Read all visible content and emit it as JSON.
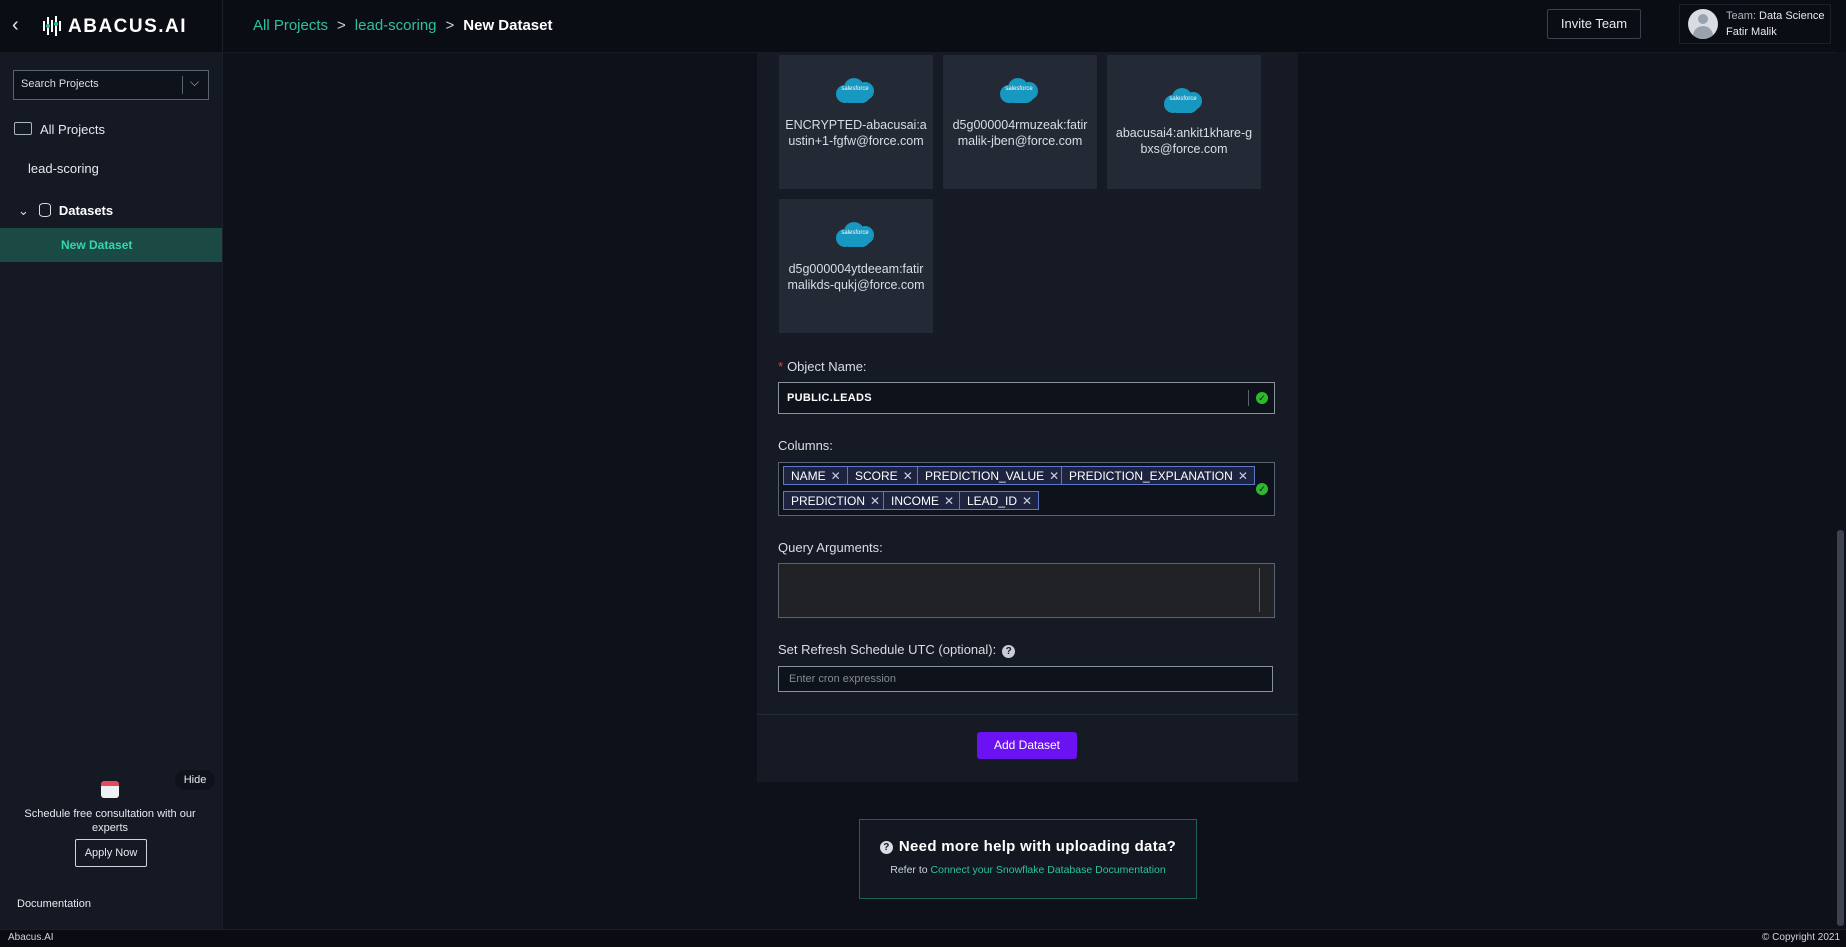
{
  "app": {
    "logo_text": "ABACUS.AI"
  },
  "breadcrumb": {
    "items": [
      "All Projects",
      "lead-scoring"
    ],
    "separator": ">",
    "current": "New Dataset"
  },
  "header": {
    "invite_label": "Invite Team",
    "team_prefix": "Team:",
    "team_name": "Data Science",
    "user_name": "Fatir Malik"
  },
  "sidebar": {
    "search_placeholder": "Search Projects",
    "all_projects": "All Projects",
    "project": "lead-scoring",
    "datasets": "Datasets",
    "new_dataset": "New Dataset",
    "promo": {
      "hide_label": "Hide",
      "text": "Schedule free consultation with our experts",
      "apply_label": "Apply Now"
    },
    "documentation": "Documentation"
  },
  "connectors": [
    {
      "logo_text": "salesforce",
      "label": "ENCRYPTED-abacusai:austin+1-fgfw@force.com"
    },
    {
      "logo_text": "salesforce",
      "label": "d5g000004rmuzeak:fatirmalik-jben@force.com"
    },
    {
      "logo_text": "salesforce",
      "label": "abacusai4:ankit1khare-gbxs@force.com"
    },
    {
      "logo_text": "salesforce",
      "label": "d5g000004ytdeeam:fatirmalikds-qukj@force.com"
    }
  ],
  "form": {
    "object_name_label": "Object Name:",
    "object_name_value": "PUBLIC.LEADS",
    "columns_label": "Columns:",
    "columns": [
      "NAME",
      "SCORE",
      "PREDICTION_VALUE",
      "PREDICTION_EXPLANATION",
      "PREDICTION",
      "INCOME",
      "LEAD_ID"
    ],
    "query_label": "Query Arguments:",
    "schedule_label": "Set Refresh Schedule UTC (optional):",
    "cron_placeholder": "Enter cron expression",
    "add_label": "Add Dataset"
  },
  "help": {
    "title": "Need more help with uploading data?",
    "sub_prefix": "Refer to",
    "link": "Connect your Snowflake Database Documentation"
  },
  "footer": {
    "brand": "Abacus.AI",
    "copyright": "© Copyright 2021"
  },
  "colors": {
    "accent": "#2cc2a0",
    "primary_button": "#6a12f2",
    "valid": "#2eb82e",
    "required": "#e0443e"
  }
}
